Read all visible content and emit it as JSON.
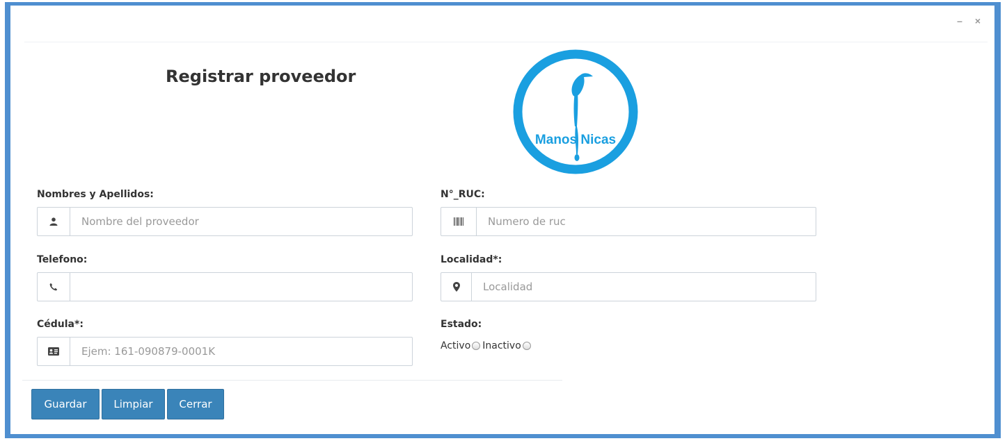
{
  "window": {
    "minimize_glyph": "–",
    "close_glyph": "×"
  },
  "header": {
    "title": "Registrar proveedor"
  },
  "logo": {
    "text": "Manos Nicas",
    "color": "#1a9fe0"
  },
  "form": {
    "nombres": {
      "label": "Nombres y Apellidos:",
      "placeholder": "Nombre del proveedor",
      "value": "",
      "icon": "user-icon"
    },
    "ruc": {
      "label": "N°_RUC:",
      "placeholder": "Numero de ruc",
      "value": "",
      "icon": "barcode-icon"
    },
    "telefono": {
      "label": "Telefono:",
      "placeholder": "",
      "value": "",
      "icon": "phone-icon"
    },
    "localidad": {
      "label": "Localidad*:",
      "placeholder": "Localidad",
      "value": "",
      "icon": "map-marker-icon"
    },
    "cedula": {
      "label": "Cédula*:",
      "placeholder": "Ejem: 161-090879-0001K",
      "value": "",
      "icon": "id-card-icon"
    },
    "estado": {
      "label": "Estado:",
      "options": [
        "Activo",
        "Inactivo"
      ]
    }
  },
  "buttons": {
    "guardar": "Guardar",
    "limpiar": "Limpiar",
    "cerrar": "Cerrar"
  },
  "colors": {
    "frame": "#4f8fd0",
    "button": "#3a84b9"
  }
}
